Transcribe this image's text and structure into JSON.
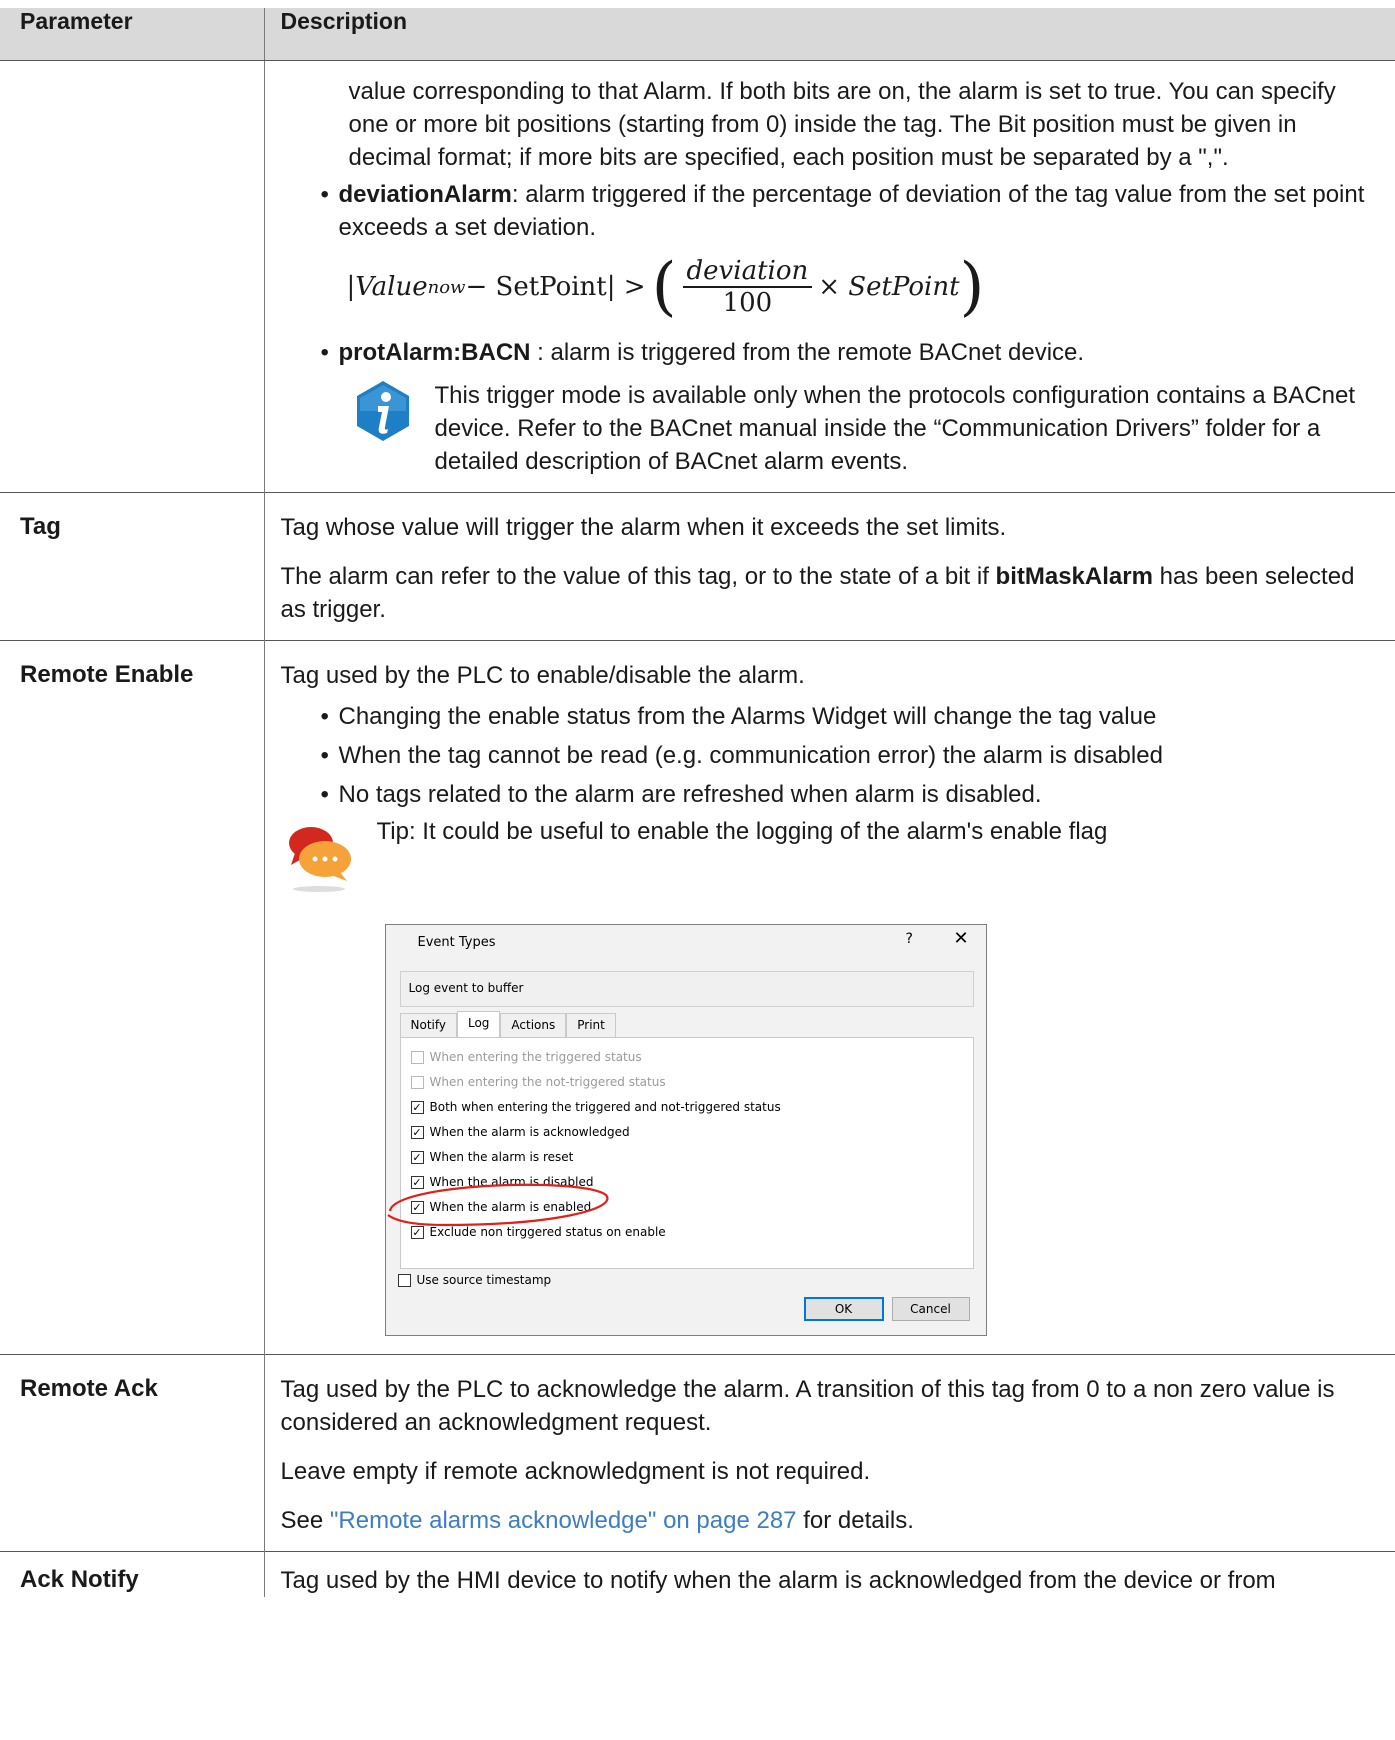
{
  "table": {
    "header": {
      "col1": "Parameter",
      "col2": "Description"
    },
    "first_row": {
      "p1": "value corresponding to that Alarm. If both bits are on, the alarm is set to true. You can specify one or more bit positions (starting from 0) inside the tag. The Bit position must be given in decimal format; if more bits are specified, each position must be separated by a \",\".",
      "deviation_name": "deviationAlarm",
      "deviation_text": ": alarm triggered if the percentage of deviation of the tag value from the set point exceeds a set deviation.",
      "formula": {
        "left": "|Value",
        "sub": "now",
        "middle": " − SetPoint| >",
        "numerator": "deviation",
        "denominator": "100",
        "right": "× SetPoint"
      },
      "prot_name": "protAlarm:BACN",
      "prot_text": " : alarm is triggered from the remote BACnet device.",
      "note": "This trigger mode is available only when the protocols configuration contains a BACnet device. Refer to the BACnet manual inside the “Communication Drivers” folder for a detailed description of BACnet alarm events."
    },
    "tag": {
      "name": "Tag",
      "p1": "Tag whose value will trigger the alarm when it exceeds the set limits.",
      "p2_a": "The alarm can refer to the value of this tag, or to the state of a bit if ",
      "p2_bold": "bitMaskAlarm",
      "p2_b": " has been selected as trigger."
    },
    "remote_enable": {
      "name": "Remote Enable",
      "p1": "Tag used by the PLC to enable/disable the alarm.",
      "bullets": [
        "Changing the enable status from the Alarms Widget will change the tag value",
        "When the tag cannot be read (e.g. communication error) the alarm is disabled",
        "No tags related to the alarm are refreshed when alarm is disabled."
      ],
      "tip": "Tip: It could be useful to enable the logging of the alarm's enable flag"
    },
    "remote_ack": {
      "name": "Remote Ack",
      "p1": "Tag used by the PLC to acknowledge the alarm. A transition of this tag from 0 to a non zero value is considered an acknowledgment request.",
      "p2": "Leave empty if remote acknowledgment is not required.",
      "p3_a": "See ",
      "p3_link": "\"Remote alarms acknowledge\" on page 287",
      "p3_b": " for details."
    },
    "ack_notify": {
      "name": "Ack Notify",
      "p1": "Tag used by the HMI device to notify when the alarm is acknowledged from the device or from"
    }
  },
  "dialog": {
    "title": "Event Types",
    "help": "?",
    "close": "✕",
    "section": "Log event to buffer",
    "tabs": [
      "Notify",
      "Log",
      "Actions",
      "Print"
    ],
    "active_tab": "Log",
    "checks": [
      {
        "label": "When entering the triggered status",
        "checked": false,
        "enabled": false
      },
      {
        "label": "When entering the not-triggered status",
        "checked": false,
        "enabled": false
      },
      {
        "label": "Both when entering the triggered and not-triggered status",
        "checked": true,
        "enabled": true
      },
      {
        "label": "When the alarm is acknowledged",
        "checked": true,
        "enabled": true
      },
      {
        "label": "When the alarm is reset",
        "checked": true,
        "enabled": true
      },
      {
        "label": "When the alarm is disabled",
        "checked": true,
        "enabled": true
      },
      {
        "label": "When the alarm is enabled",
        "checked": true,
        "enabled": true
      },
      {
        "label": "Exclude non tirggered status on enable",
        "checked": true,
        "enabled": true
      }
    ],
    "use_source_timestamp": "Use source timestamp",
    "ok": "OK",
    "cancel": "Cancel"
  },
  "colors": {
    "link": "#3c7dc4",
    "header_bg": "#d9d9d9",
    "highlight": "#e0211b",
    "info_icon": "#1f7fc6"
  },
  "icons": {
    "info": "info-icon",
    "tip": "chat-bubbles-icon"
  }
}
